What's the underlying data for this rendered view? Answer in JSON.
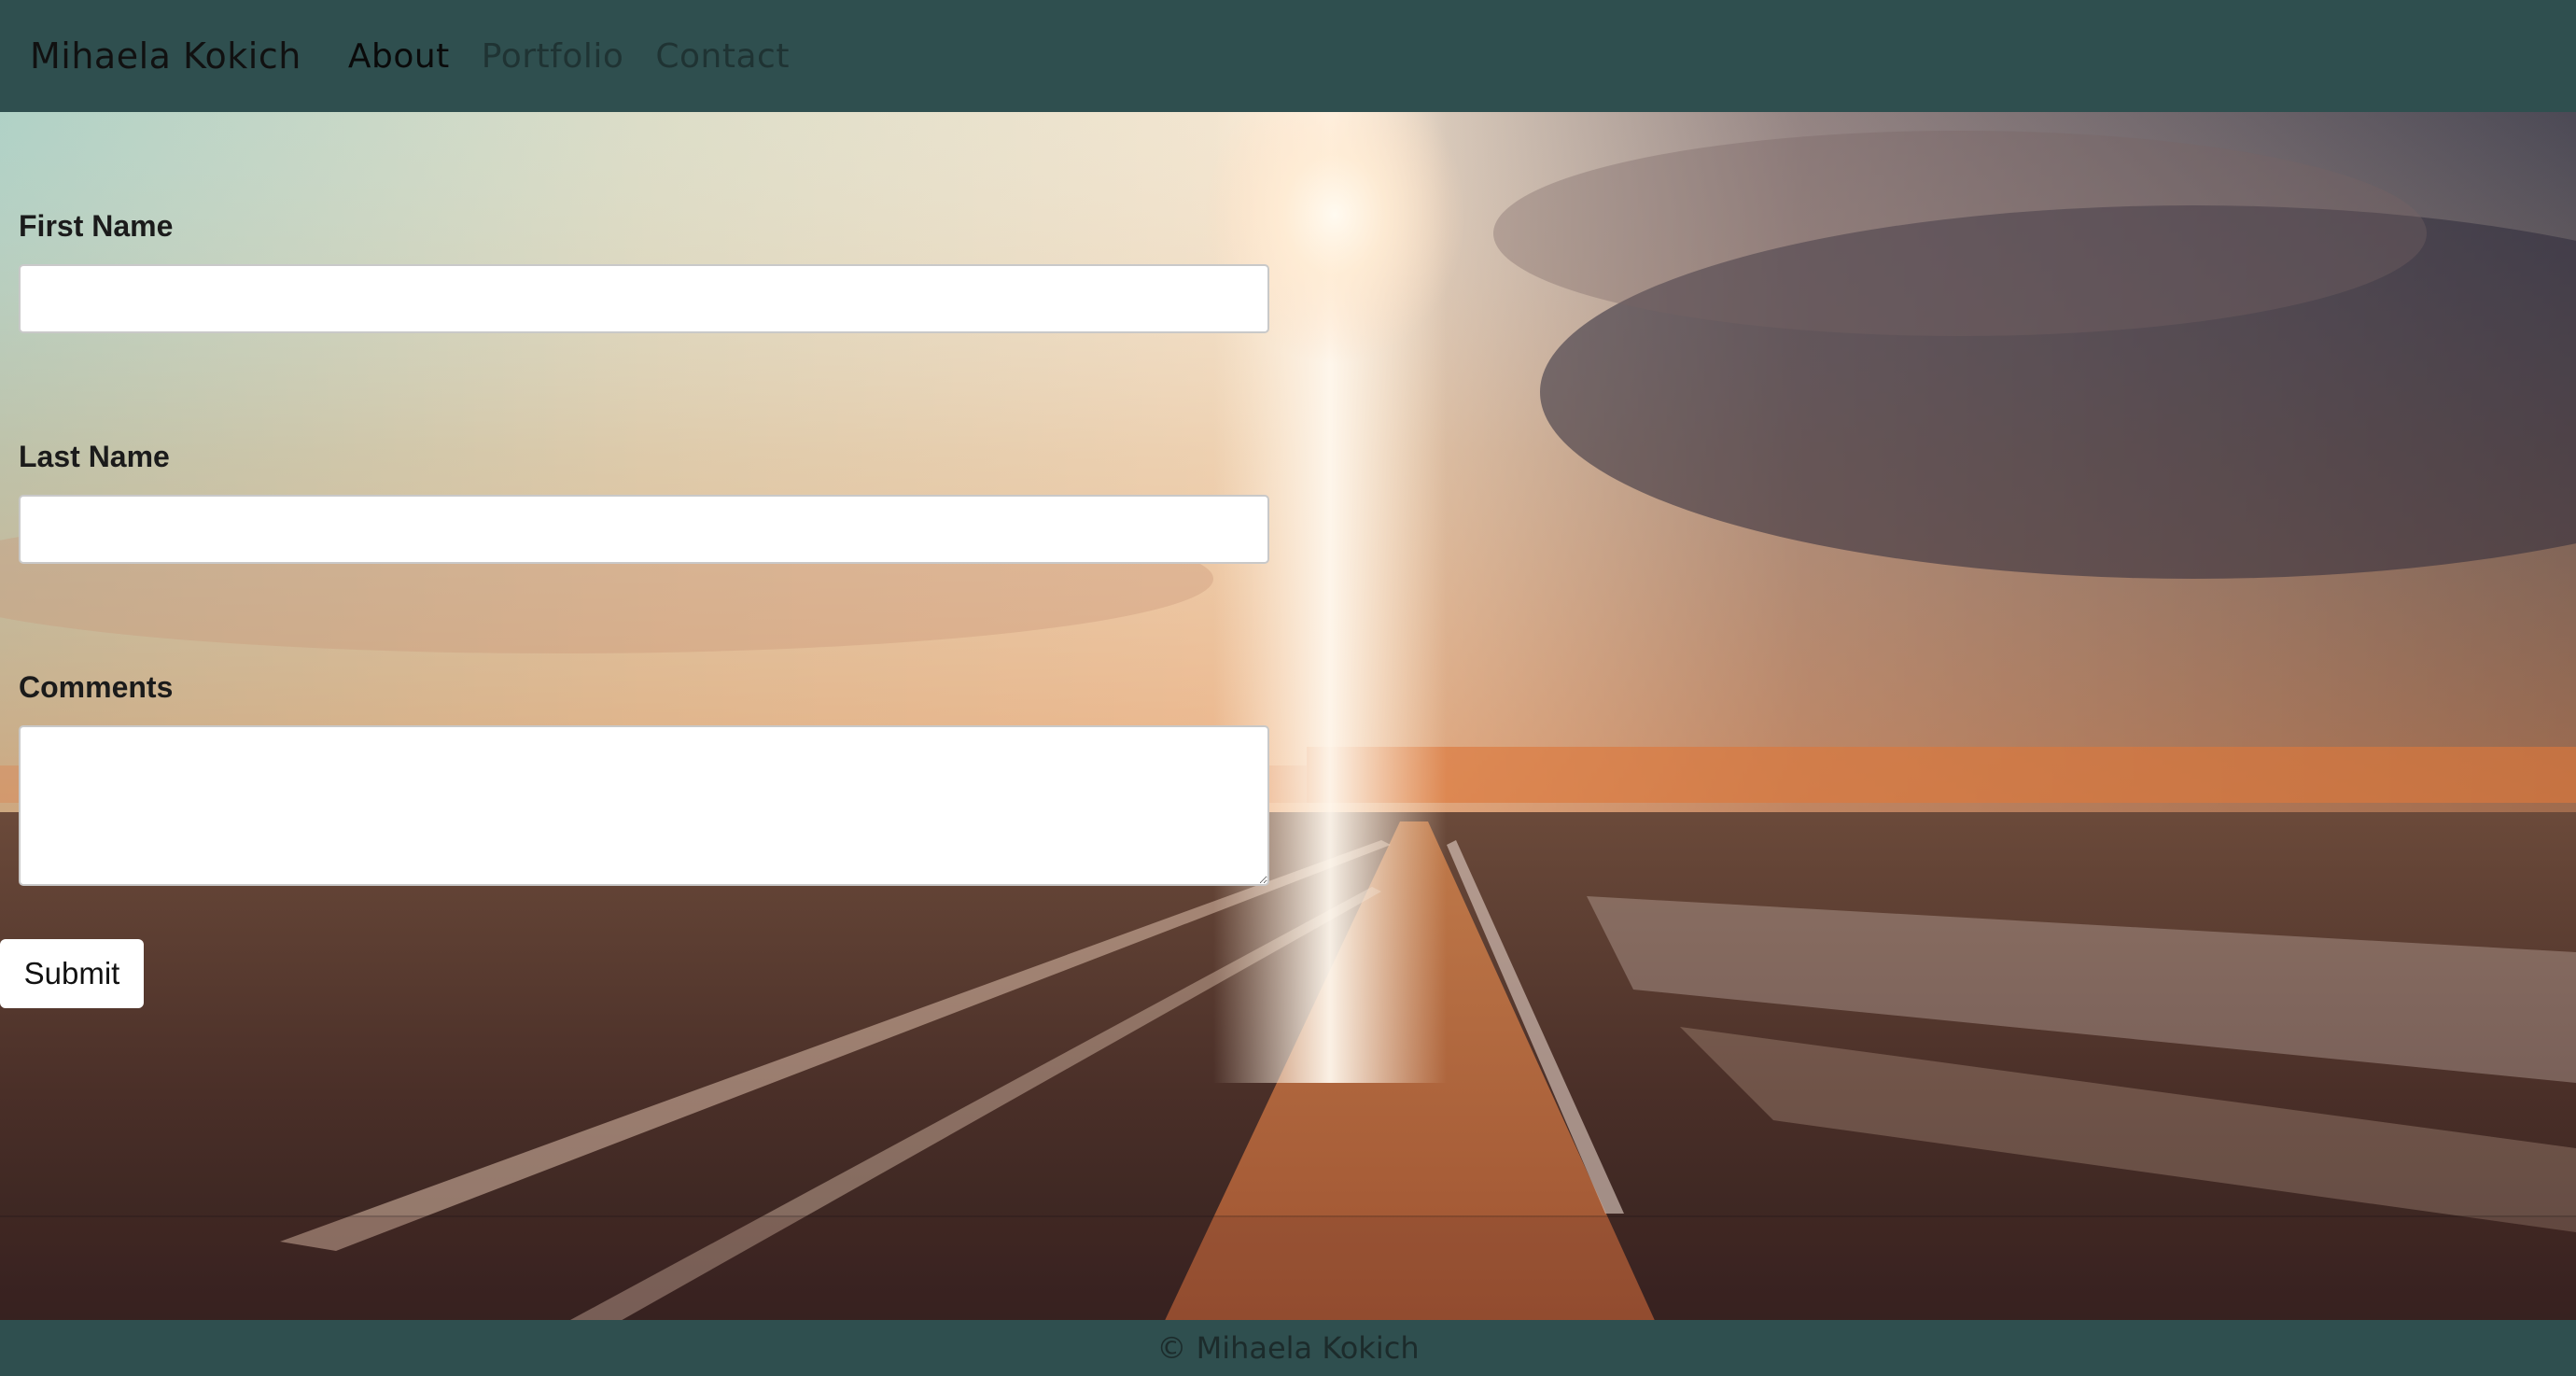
{
  "navbar": {
    "brand": "Mihaela Kokich",
    "links": [
      {
        "label": "About",
        "active": true
      },
      {
        "label": "Portfolio",
        "active": false
      },
      {
        "label": "Contact",
        "active": false
      }
    ],
    "background_color": "#2f4f4f"
  },
  "form": {
    "first_name_label": "First Name",
    "first_name_value": "",
    "last_name_label": "Last Name",
    "last_name_value": "",
    "comments_label": "Comments",
    "comments_value": "",
    "submit_label": "Submit"
  },
  "footer": {
    "text": "© Mihaela Kokich",
    "background_color": "#2f4f4f"
  }
}
